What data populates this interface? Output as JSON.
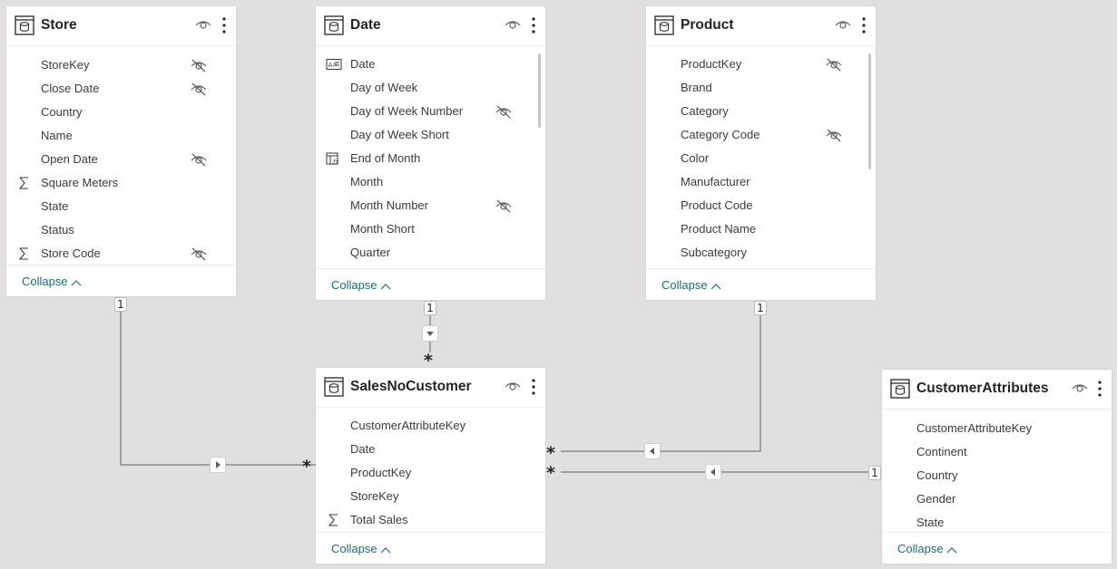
{
  "colors": {
    "canvas": "#e1e0df",
    "collapse_link": "#1e6b73",
    "line": "#5f5f5f"
  },
  "tables": {
    "store": {
      "title": "Store",
      "fields": [
        {
          "label": "StoreKey",
          "icon": "",
          "hidden": true
        },
        {
          "label": "Close Date",
          "icon": "",
          "hidden": true
        },
        {
          "label": "Country",
          "icon": "",
          "hidden": false
        },
        {
          "label": "Name",
          "icon": "",
          "hidden": false
        },
        {
          "label": "Open Date",
          "icon": "",
          "hidden": true
        },
        {
          "label": "Square Meters",
          "icon": "sigma-icon",
          "hidden": false
        },
        {
          "label": "State",
          "icon": "",
          "hidden": false
        },
        {
          "label": "Status",
          "icon": "",
          "hidden": false
        },
        {
          "label": "Store Code",
          "icon": "sigma-icon",
          "hidden": true
        }
      ],
      "collapse_label": "Collapse"
    },
    "date": {
      "title": "Date",
      "fields": [
        {
          "label": "Date",
          "icon": "date-field-icon",
          "hidden": false
        },
        {
          "label": "Day of Week",
          "icon": "",
          "hidden": false
        },
        {
          "label": "Day of Week Number",
          "icon": "",
          "hidden": true
        },
        {
          "label": "Day of Week Short",
          "icon": "",
          "hidden": false
        },
        {
          "label": "End of Month",
          "icon": "calculated-column-icon",
          "hidden": false
        },
        {
          "label": "Month",
          "icon": "",
          "hidden": false
        },
        {
          "label": "Month Number",
          "icon": "",
          "hidden": true
        },
        {
          "label": "Month Short",
          "icon": "",
          "hidden": false
        },
        {
          "label": "Quarter",
          "icon": "",
          "hidden": false
        }
      ],
      "collapse_label": "Collapse"
    },
    "product": {
      "title": "Product",
      "fields": [
        {
          "label": "ProductKey",
          "icon": "",
          "hidden": true
        },
        {
          "label": "Brand",
          "icon": "",
          "hidden": false
        },
        {
          "label": "Category",
          "icon": "",
          "hidden": false
        },
        {
          "label": "Category Code",
          "icon": "",
          "hidden": true
        },
        {
          "label": "Color",
          "icon": "",
          "hidden": false
        },
        {
          "label": "Manufacturer",
          "icon": "",
          "hidden": false
        },
        {
          "label": "Product Code",
          "icon": "",
          "hidden": false
        },
        {
          "label": "Product Name",
          "icon": "",
          "hidden": false
        },
        {
          "label": "Subcategory",
          "icon": "",
          "hidden": false
        }
      ],
      "collapse_label": "Collapse"
    },
    "sales": {
      "title": "SalesNoCustomer",
      "fields": [
        {
          "label": "CustomerAttributeKey",
          "icon": "",
          "hidden": false
        },
        {
          "label": "Date",
          "icon": "",
          "hidden": false
        },
        {
          "label": "ProductKey",
          "icon": "",
          "hidden": false
        },
        {
          "label": "StoreKey",
          "icon": "",
          "hidden": false
        },
        {
          "label": "Total Sales",
          "icon": "sigma-icon",
          "hidden": false
        }
      ],
      "collapse_label": "Collapse"
    },
    "customer": {
      "title": "CustomerAttributes",
      "fields": [
        {
          "label": "CustomerAttributeKey",
          "icon": "",
          "hidden": false
        },
        {
          "label": "Continent",
          "icon": "",
          "hidden": false
        },
        {
          "label": "Country",
          "icon": "",
          "hidden": false
        },
        {
          "label": "Gender",
          "icon": "",
          "hidden": false
        },
        {
          "label": "State",
          "icon": "",
          "hidden": false
        }
      ],
      "collapse_label": "Collapse"
    }
  },
  "relationships": {
    "one_label": "1",
    "many_label": "*"
  }
}
